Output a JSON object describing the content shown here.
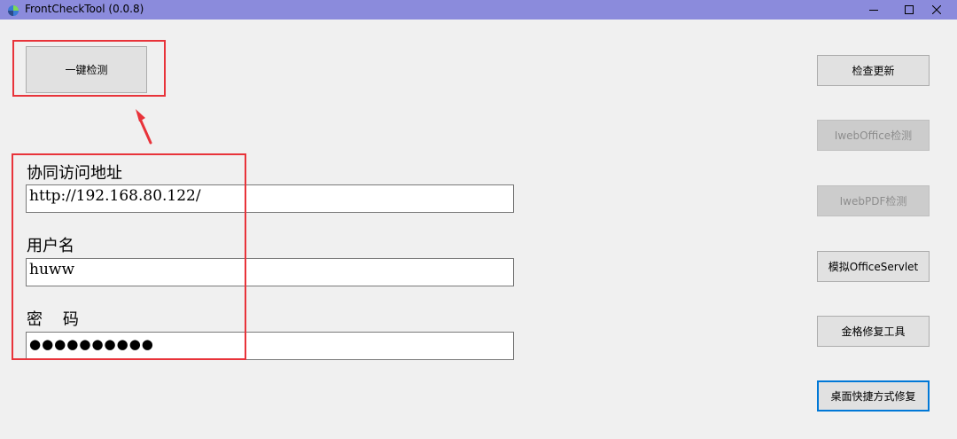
{
  "window": {
    "title": "FrontCheckTool (0.0.8)",
    "app_icon": "app-logo-icon",
    "controls": [
      "minimize-icon",
      "maximize-icon",
      "close-icon"
    ]
  },
  "main": {
    "one_click_check_label": "一键检测",
    "form": {
      "url_label": "协同访问地址",
      "url_value": "http://192.168.80.122/",
      "username_label": "用户名",
      "username_value": "huww",
      "password_label": "密    码",
      "password_value": "●●●●●●●●●●"
    }
  },
  "right_panel": {
    "buttons": [
      {
        "label": "检查更新",
        "enabled": true
      },
      {
        "label": "IwebOffice检测",
        "enabled": false
      },
      {
        "label": "IwebPDF检测",
        "enabled": false
      },
      {
        "label": "模拟OfficeServlet",
        "enabled": true
      },
      {
        "label": "金格修复工具",
        "enabled": true
      },
      {
        "label": "桌面快捷方式修复",
        "enabled": true,
        "focused": true
      }
    ]
  },
  "colors": {
    "titlebar": "#8b8bdc",
    "annotation": "#e8333a",
    "focus_border": "#0078d7"
  }
}
